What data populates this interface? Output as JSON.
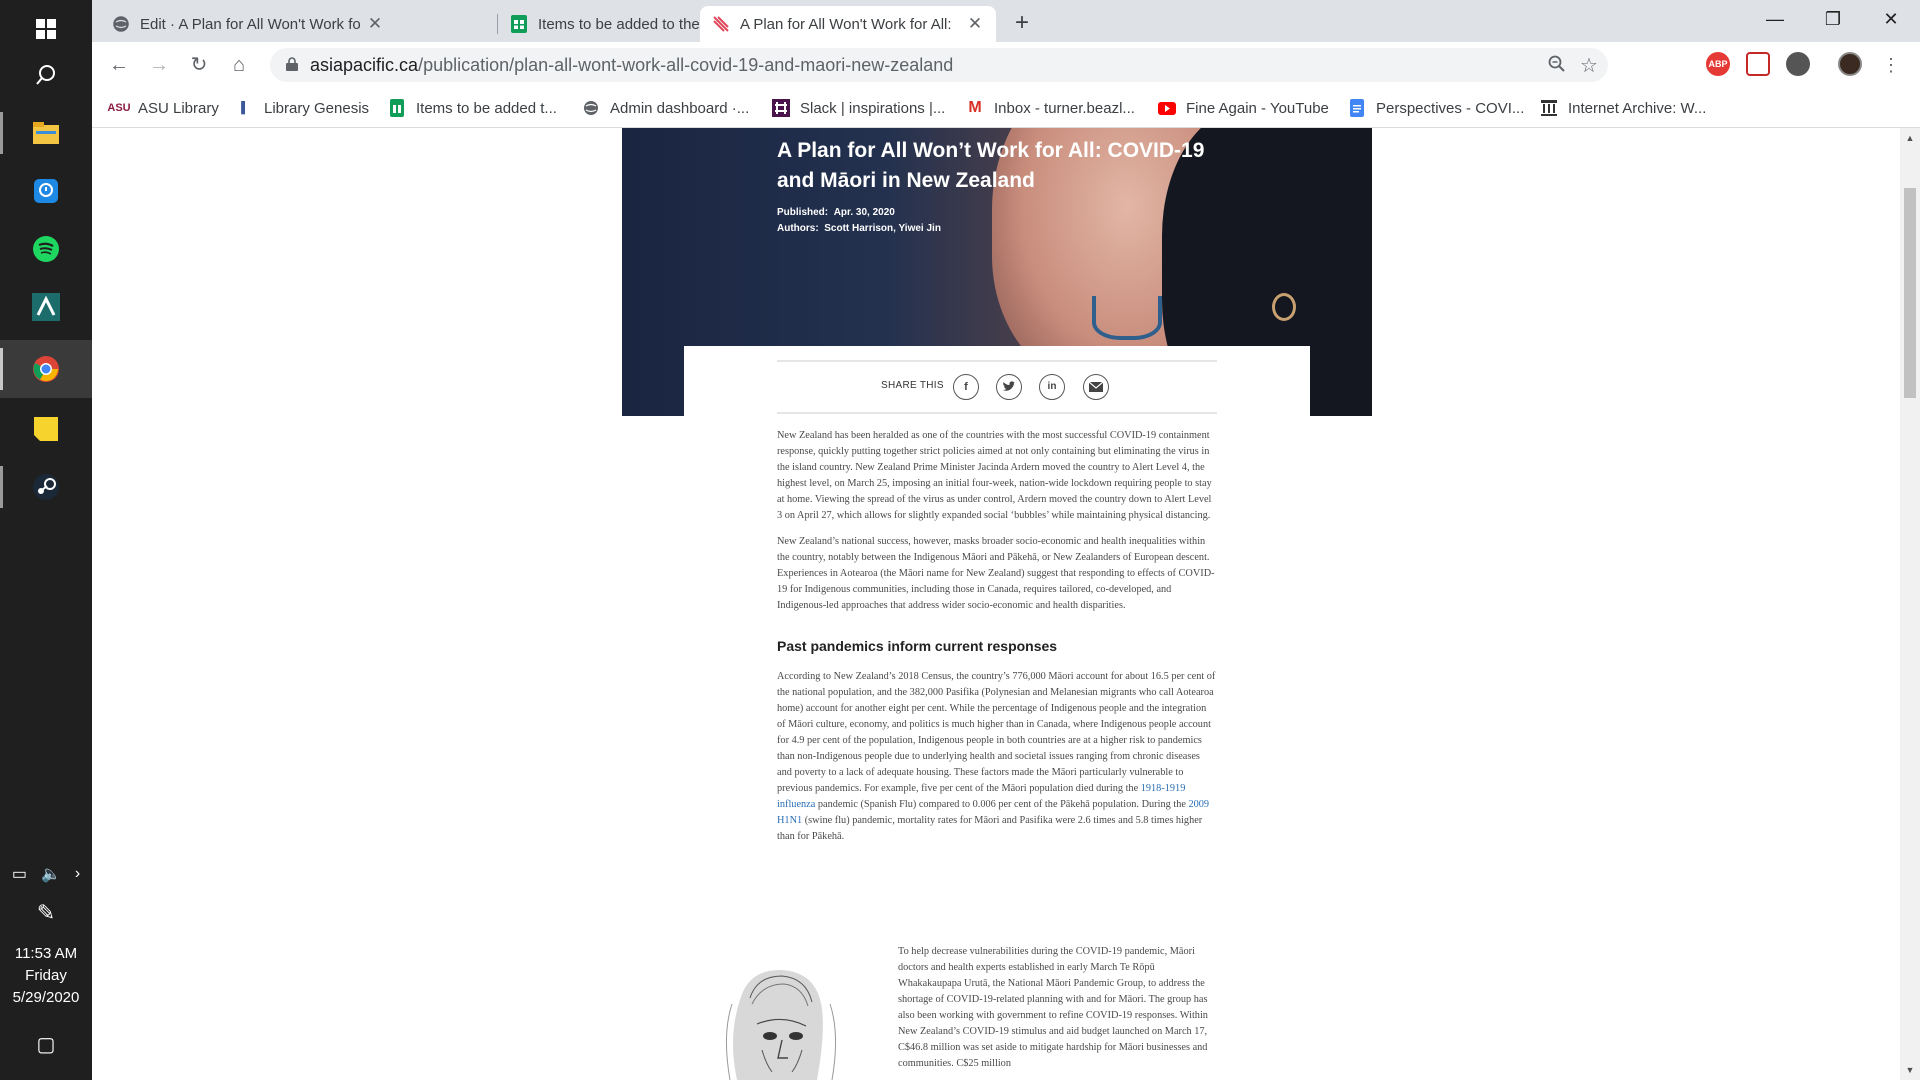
{
  "taskbar": {
    "icons": [
      "windows-start-icon",
      "search-icon",
      "file-explorer-icon",
      "help-icon",
      "spotify-icon",
      "app-icon",
      "chrome-icon",
      "sticky-notes-icon",
      "steam-icon"
    ],
    "clock": {
      "time": "11:53 AM",
      "day": "Friday",
      "date": "5/29/2020"
    }
  },
  "browser": {
    "tabs": [
      {
        "title": "Edit · A Plan for All Won't Work fo",
        "active": false
      },
      {
        "title": "Items to be added to the Indigen",
        "active": false
      },
      {
        "title": "A Plan for All Won't Work for All:",
        "active": true
      }
    ],
    "url_host": "asiapacific.ca",
    "url_path": "/publication/plan-all-wont-work-all-covid-19-and-maori-new-zealand",
    "extensions": {
      "abp": "ABP"
    },
    "bookmarks": [
      {
        "label": "ASU Library",
        "icon": "asu-icon",
        "color": "#8c1d40"
      },
      {
        "label": "Library Genesis",
        "icon": "libgen-icon",
        "color": "#3b5998"
      },
      {
        "label": "Items to be added t...",
        "icon": "sheets-icon",
        "color": "#0f9d58"
      },
      {
        "label": "Admin dashboard ·...",
        "icon": "globe-icon",
        "color": "#5f6368"
      },
      {
        "label": "Slack | inspirations |...",
        "icon": "slack-icon",
        "color": "#4a154b"
      },
      {
        "label": "Inbox - turner.beazl...",
        "icon": "gmail-icon",
        "color": "#d93025"
      },
      {
        "label": "Fine Again - YouTube",
        "icon": "youtube-icon",
        "color": "#ff0000"
      },
      {
        "label": "Perspectives - COVI...",
        "icon": "docs-icon",
        "color": "#4285f4"
      },
      {
        "label": "Internet Archive: W...",
        "icon": "archive-icon",
        "color": "#333333"
      }
    ]
  },
  "article": {
    "title": "A Plan for All Won’t Work for All: COVID-19 and Māori in New Zealand",
    "published_label": "Published:",
    "published_value": "Apr. 30, 2020",
    "authors_label": "Authors:",
    "authors_value": "Scott Harrison, Yiwei Jin",
    "share_label": "SHARE THIS",
    "paragraphs": [
      "New Zealand has been heralded as one of the countries with the most successful COVID-19 containment response, quickly putting together strict policies aimed at not only containing but eliminating the virus in the island country. New Zealand Prime Minister Jacinda Ardern moved the country to Alert Level 4, the highest level, on March 25, imposing an initial four-week, nation-wide lockdown requiring people to stay at home. Viewing the spread of the virus as under control, Ardern moved the country down to Alert Level 3 on April 27, which allows for slightly expanded social ‘bubbles’ while maintaining physical distancing.",
      "New Zealand’s national success, however, masks broader socio-economic and health inequalities within the country, notably between the Indigenous Māori and Pākehā, or New Zealanders of European descent. Experiences in Aotearoa (the Māori name for New Zealand) suggest that responding to effects of COVID-19 for Indigenous communities, including those in Canada, requires tailored, co-developed, and Indigenous-led approaches that address wider socio-economic and health disparities."
    ],
    "section_heading": "Past pandemics inform current responses",
    "section_para_a": "According to New Zealand’s 2018 Census, the country’s 776,000 Māori account for about 16.5 per cent of the national population, and the 382,000 Pasifika (Polynesian and Melanesian migrants who call Aotearoa home) account for another eight per cent. While the percentage of Indigenous people and the integration of Māori culture, economy, and politics is much higher than in Canada, where Indigenous people account for 4.9 per cent of the population, Indigenous people in both countries are at a higher risk to pandemics than non-Indigenous people due to underlying health and societal issues ranging from chronic diseases and poverty to a lack of adequate housing. These factors made the Māori particularly vulnerable to previous pandemics. For example, five per cent of the Māori population died during the ",
    "link_influenza": "1918-1919 influenza",
    "section_para_b": " pandemic (Spanish Flu) compared to 0.006 per cent of the Pākehā population. During the ",
    "link_h1n1": "2009 H1N1",
    "section_para_c": " (swine flu) pandemic, mortality rates for Māori and Pasifika were 2.6 times and 5.8 times higher than for Pākehā.",
    "figure_para": "To help decrease vulnerabilities during the COVID-19 pandemic, Māori doctors and health experts established in early March Te Rōpū Whakakaupapa Urutā, the National Māori Pandemic Group, to address the shortage of COVID-19-related planning with and for Māori. The group has also been working with government to refine COVID-19 responses. Within New Zealand’s COVID-19 stimulus and aid budget launched on March 17, C$46.8 million was set aside to mitigate hardship for Māori businesses and communities. C$25 million"
  }
}
